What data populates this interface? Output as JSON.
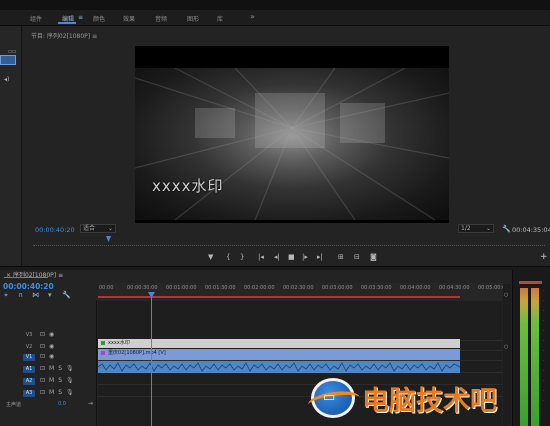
{
  "workspaces": {
    "items": [
      {
        "label": "组件"
      },
      {
        "label": "编辑"
      },
      {
        "label": "颜色"
      },
      {
        "label": "效果"
      },
      {
        "label": "音频"
      },
      {
        "label": "图形"
      },
      {
        "label": "库"
      }
    ],
    "active_suffix": "≡",
    "more": "»"
  },
  "program_monitor": {
    "title": "节目: 序列02[1080P]",
    "title_menu": "≡",
    "watermark": "xxxx水印",
    "timecode_current": "00:00:40:20",
    "fit": "适合",
    "quality": "1/2",
    "timecode_duration": "00:04:35:04"
  },
  "timeline": {
    "tab": "序列02[1080P]",
    "tab_menu": "≡",
    "timecode": "00:00:40:20",
    "ruler": [
      "00:00",
      "00:00:30:00",
      "00:01:00:00",
      "00:01:30:00",
      "00:02:00:00",
      "00:02:30:00",
      "00:03:00:00",
      "00:03:30:00",
      "00:04:00:00",
      "00:04:30:00",
      "00:05:00:00"
    ],
    "tracks": [
      {
        "name": "V3",
        "selected": false
      },
      {
        "name": "V2",
        "selected": false
      },
      {
        "name": "V1",
        "selected": true
      },
      {
        "name": "A1",
        "selected": true
      },
      {
        "name": "A2",
        "selected": true
      },
      {
        "name": "A3",
        "selected": true
      }
    ],
    "master": {
      "label": "主声道",
      "value": "0.0"
    },
    "clip_text": "xxxx水印",
    "clip_video": "重庆02[1080P].mp4 [V]"
  },
  "logo": {
    "text": "电脑技术吧"
  },
  "colors": {
    "accent": "#4e86d8",
    "timecode": "#3a8ee6",
    "inout_bar": "#b83232",
    "logo_orange": "#e8791c"
  }
}
